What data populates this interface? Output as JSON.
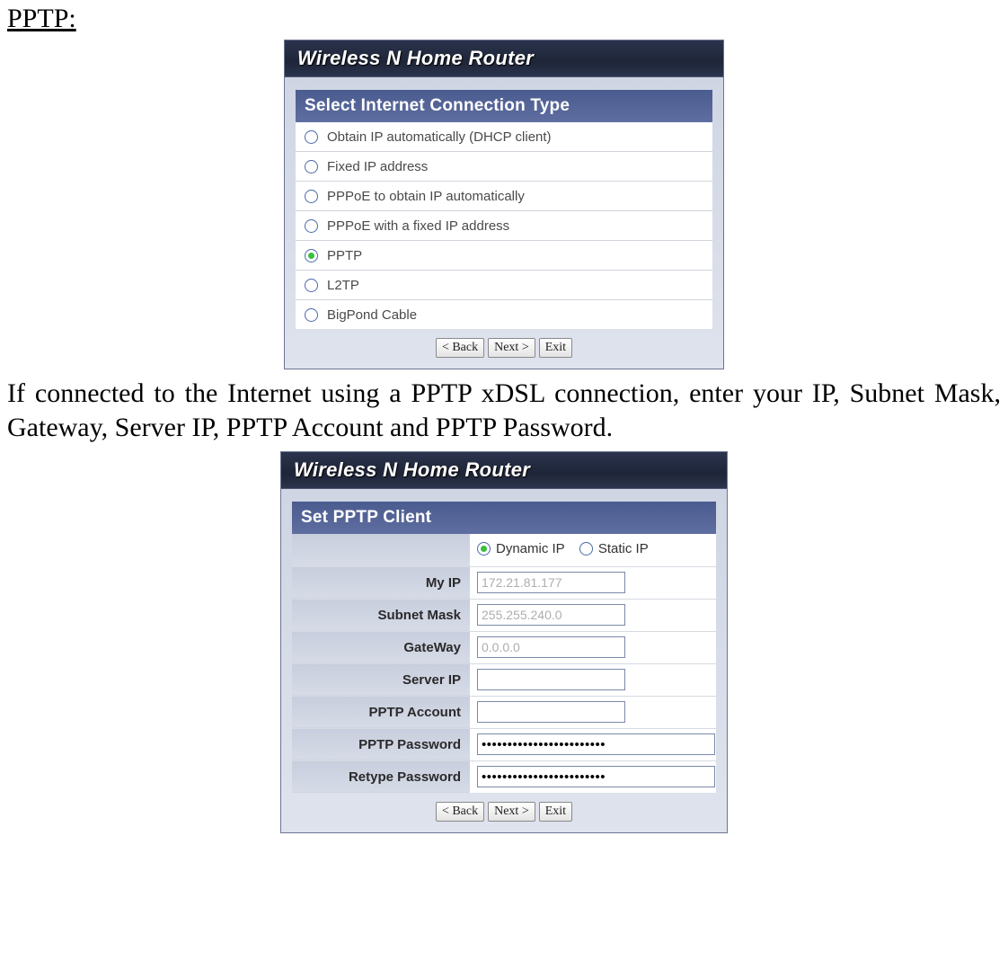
{
  "doc": {
    "heading": "PPTP:",
    "paragraph": "If connected to the Internet using a PPTP xDSL connection, enter your IP, Subnet Mask, Gateway, Server IP, PPTP Account and PPTP Password."
  },
  "panel1": {
    "brand": "Wireless N Home Router",
    "sectionTitle": "Select Internet Connection Type",
    "options": [
      {
        "label": "Obtain IP automatically (DHCP client)",
        "selected": false
      },
      {
        "label": "Fixed IP address",
        "selected": false
      },
      {
        "label": "PPPoE to obtain IP automatically",
        "selected": false
      },
      {
        "label": "PPPoE with a fixed IP address",
        "selected": false
      },
      {
        "label": "PPTP",
        "selected": true
      },
      {
        "label": "L2TP",
        "selected": false
      },
      {
        "label": "BigPond Cable",
        "selected": false
      }
    ],
    "buttons": {
      "back": "< Back",
      "next": "Next >",
      "exit": "Exit"
    }
  },
  "panel2": {
    "brand": "Wireless N Home Router",
    "sectionTitle": "Set PPTP Client",
    "ipMode": {
      "dynamicLabel": "Dynamic IP",
      "staticLabel": "Static IP",
      "selected": "dynamic"
    },
    "fields": {
      "myIpLabel": "My IP",
      "myIp": "172.21.81.177",
      "subnetLabel": "Subnet Mask",
      "subnet": "255.255.240.0",
      "gatewayLabel": "GateWay",
      "gateway": "0.0.0.0",
      "serverIpLabel": "Server IP",
      "serverIp": "",
      "accountLabel": "PPTP Account",
      "account": "",
      "passwordLabel": "PPTP Password",
      "password": "••••••••••••••••••••••••",
      "retypeLabel": "Retype Password",
      "retype": "••••••••••••••••••••••••"
    },
    "buttons": {
      "back": "< Back",
      "next": "Next >",
      "exit": "Exit"
    }
  }
}
